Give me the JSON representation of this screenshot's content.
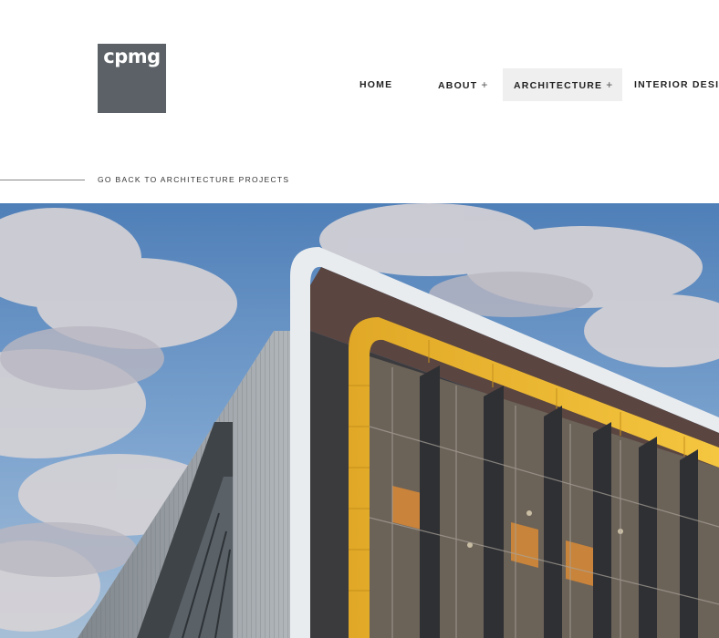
{
  "logo": {
    "text": "cpmg"
  },
  "nav": {
    "items": [
      {
        "label": "HOME",
        "has_submenu": false
      },
      {
        "label": "ABOUT",
        "has_submenu": true
      },
      {
        "label": "ARCHITECTURE",
        "has_submenu": true,
        "active": true
      },
      {
        "label": "INTERIOR DESIG",
        "has_submenu": false
      }
    ],
    "plus_symbol": "+"
  },
  "back_link": {
    "label": "GO BACK TO ARCHITECTURE PROJECTS"
  },
  "hero": {
    "subject": "modern building facade with yellow frame and vertical fins against cloudy blue sky"
  }
}
